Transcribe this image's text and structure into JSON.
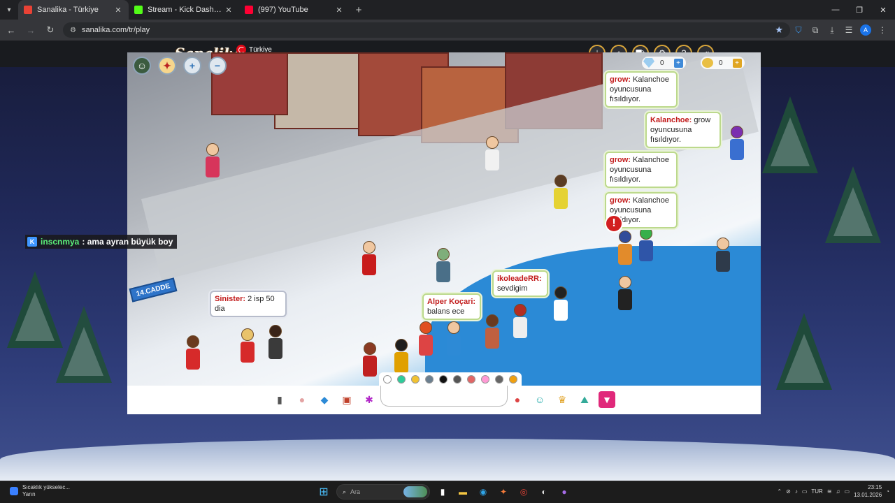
{
  "browser": {
    "tabs": [
      {
        "title": "Sanalika - Türkiye",
        "active": true,
        "favicon_color": "#e94235"
      },
      {
        "title": "Stream - Kick Dashboard",
        "active": false,
        "favicon_color": "#53fc18"
      },
      {
        "title": "(997) YouTube",
        "active": false,
        "favicon_color": "#ff0033"
      }
    ],
    "url": "sanalika.com/tr/play"
  },
  "site": {
    "logo": "Sanalika",
    "language": "Türkiye",
    "header_buttons": [
      "download-icon",
      "home-icon",
      "cart-icon",
      "gear-icon",
      "help-icon",
      "logout-icon"
    ]
  },
  "game": {
    "street_sign": "14.CADDE",
    "currency": {
      "diamonds": "0",
      "coins": "0"
    },
    "chat_bubbles": [
      {
        "name": "grow:",
        "text": "Kalanchoe oyuncusuna fısıldıyor."
      },
      {
        "name": "Kalanchoe:",
        "text": "grow oyuncusuna fısıldıyor."
      },
      {
        "name": "grow:",
        "text": "Kalanchoe oyuncusuna fısıldıyor."
      },
      {
        "name": "grow:",
        "text": "Kalanchoe oyuncusuna fısıldıyor."
      },
      {
        "name": "ikoleadeRR:",
        "text": "sevdigim"
      },
      {
        "name": "Alper Koçari:",
        "text": "balans ece"
      },
      {
        "name": "Sinister:",
        "text": "2 isp 50 dia"
      }
    ],
    "color_swatches": [
      "#ffffff",
      "#2ecc9a",
      "#f1c232",
      "#6b7f8f",
      "#111111",
      "#555555",
      "#e06666",
      "#ff9ad5",
      "#666666",
      "#f0a010"
    ]
  },
  "stream_overlay": {
    "user": "inscnmya",
    "message": ": ama ayran büyük boy"
  },
  "taskbar": {
    "weather_line1": "Sıcaklık yükselec...",
    "weather_line2": "Yarın",
    "search_placeholder": "Ara",
    "lang": "TUR",
    "time": "23:15",
    "date": "13.01.2026"
  }
}
